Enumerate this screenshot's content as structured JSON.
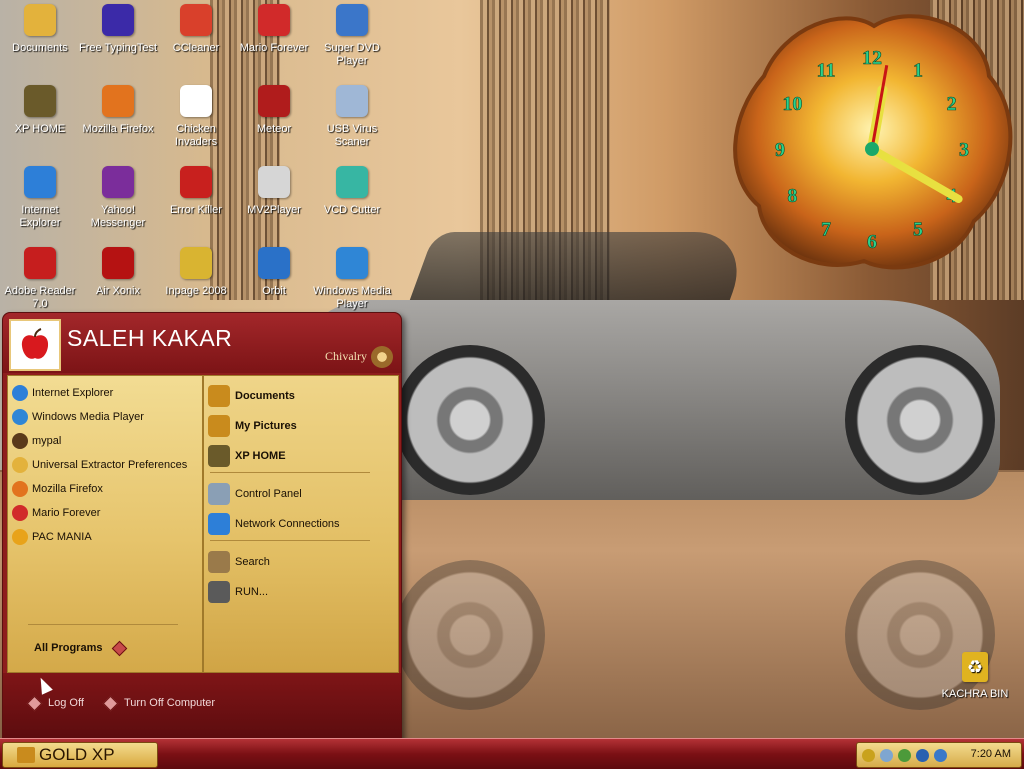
{
  "desktop": {
    "icons": [
      {
        "label": "Documents",
        "icon": "folder-icon",
        "color": "#e3b23c"
      },
      {
        "label": "Free TypingTest",
        "icon": "typing-test-icon",
        "color": "#3b2aa8"
      },
      {
        "label": "CCleaner",
        "icon": "ccleaner-icon",
        "color": "#d9402b"
      },
      {
        "label": "Mario Forever",
        "icon": "mario-icon",
        "color": "#d12a2a"
      },
      {
        "label": "Super DVD Player",
        "icon": "dvd-player-icon",
        "color": "#3b76c9"
      },
      {
        "label": "XP HOME",
        "icon": "computer-icon",
        "color": "#6a5a2a"
      },
      {
        "label": "Mozilla Firefox",
        "icon": "firefox-icon",
        "color": "#e2731e"
      },
      {
        "label": "Chicken Invaders",
        "icon": "chicken-icon",
        "color": "#ffffff"
      },
      {
        "label": "Meteor",
        "icon": "meteor-icon",
        "color": "#b01c1c"
      },
      {
        "label": "USB Virus Scaner",
        "icon": "usb-icon",
        "color": "#9fb7d6"
      },
      {
        "label": "Internet Explorer",
        "icon": "internet-explorer-icon",
        "color": "#2d7fd8"
      },
      {
        "label": "Yahoo! Messenger",
        "icon": "yahoo-messenger-icon",
        "color": "#7b2d9b"
      },
      {
        "label": "Error Killer",
        "icon": "error-killer-icon",
        "color": "#c8201e"
      },
      {
        "label": "MV2Player",
        "icon": "mv2player-icon",
        "color": "#d6d6d6"
      },
      {
        "label": "VCD Cutter",
        "icon": "vcd-cutter-icon",
        "color": "#37b6a3"
      },
      {
        "label": "Adobe Reader 7.0",
        "icon": "adobe-reader-icon",
        "color": "#c61e1e"
      },
      {
        "label": "Air Xonix",
        "icon": "air-xonix-icon",
        "color": "#b51212"
      },
      {
        "label": "Inpage 2008",
        "icon": "inpage-icon",
        "color": "#d9b431"
      },
      {
        "label": "Orbit",
        "icon": "orbit-icon",
        "color": "#2a71c8"
      },
      {
        "label": "Windows Media Player",
        "icon": "media-player-icon",
        "color": "#2f86d6"
      }
    ],
    "recycle_bin": {
      "label": "KACHRA BIN",
      "icon": "recycle-bin-icon"
    }
  },
  "clock": {
    "numerals": [
      "12",
      "1",
      "2",
      "3",
      "4",
      "5",
      "6",
      "7",
      "8",
      "9",
      "10",
      "11"
    ],
    "time_hours": 12,
    "time_minutes": 20,
    "numeral_color": "#2bd18b"
  },
  "start_menu": {
    "username": "SALEH KAKAR",
    "theme_name": "Chivalry",
    "avatar_icon": "apple-icon",
    "pinned": [
      {
        "label": "Internet Explorer",
        "icon": "internet-explorer-icon",
        "color": "#2d7fd8"
      },
      {
        "label": "Windows Media Player",
        "icon": "media-player-icon",
        "color": "#2f86d6"
      },
      {
        "label": "mypal",
        "icon": "mypal-icon",
        "color": "#5a3a1a"
      },
      {
        "label": "Universal Extractor Preferences",
        "icon": "extractor-icon",
        "color": "#e3b23c"
      },
      {
        "label": "Mozilla Firefox",
        "icon": "firefox-icon",
        "color": "#e2731e"
      },
      {
        "label": "Mario Forever",
        "icon": "mario-icon",
        "color": "#d12a2a"
      },
      {
        "label": "PAC MANIA",
        "icon": "pacman-icon",
        "color": "#e8a31a"
      }
    ],
    "all_programs_label": "All Programs",
    "places": [
      {
        "label": "Documents",
        "icon": "folder-icon",
        "bold": true,
        "color": "#c98b1d"
      },
      {
        "label": "My Pictures",
        "icon": "pictures-folder-icon",
        "bold": true,
        "color": "#c98b1d"
      },
      {
        "label": "XP HOME",
        "icon": "computer-icon",
        "bold": true,
        "color": "#6a5a2a"
      }
    ],
    "settings": [
      {
        "label": "Control Panel",
        "icon": "control-panel-icon",
        "color": "#8a9fb5"
      },
      {
        "label": "Network Connections",
        "icon": "network-icon",
        "color": "#2d7fd8"
      }
    ],
    "tools": [
      {
        "label": "Search",
        "icon": "search-icon",
        "color": "#9a7a4a"
      },
      {
        "label": "RUN...",
        "icon": "run-icon",
        "color": "#5a5a5a"
      }
    ],
    "log_off_label": "Log Off",
    "turn_off_label": "Turn Off Computer"
  },
  "taskbar": {
    "start_label": "GOLD XP",
    "tray_icons": [
      {
        "icon": "yahoo-tray-icon",
        "color": "#c9a21d"
      },
      {
        "icon": "antivirus-tray-icon",
        "color": "#7fa6d0"
      },
      {
        "icon": "network-tray-icon",
        "color": "#4c9a3a"
      },
      {
        "icon": "download-tray-icon",
        "color": "#2a61b0"
      },
      {
        "icon": "update-tray-icon",
        "color": "#3a78c8"
      }
    ],
    "time": "7:20 AM"
  },
  "colors": {
    "start_menu_red": "#8e1d1d",
    "gold": "#e6c46c"
  }
}
